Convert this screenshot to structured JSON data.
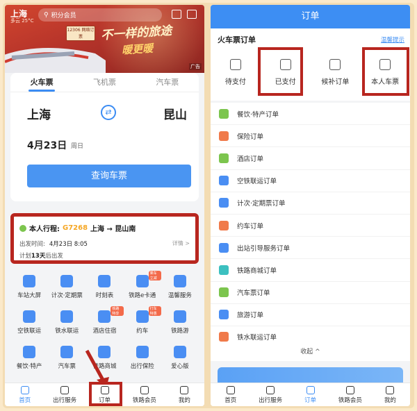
{
  "left": {
    "city": "上海",
    "weather": "多云 25°C",
    "search_placeholder": "积分会员",
    "banner_badge": "12306 网络订票",
    "slogan_1": "不一样的旅途",
    "slogan_2": "暖更暖",
    "ad_label": "广告",
    "tabs": [
      "火车票",
      "飞机票",
      "汽车票"
    ],
    "from": "上海",
    "to": "昆山",
    "date": "4月23日",
    "weekday": "周日",
    "query_button": "查询车票",
    "trip": {
      "label": "本人行程:",
      "train_no": "G7268",
      "route": "上海 → 昆山南",
      "depart_label": "出发时间:",
      "depart_value": "4月23日  8:05",
      "detail": "详情 >",
      "plan_prefix": "计划",
      "plan_days": "13天",
      "plan_suffix": "后出发"
    },
    "services": [
      {
        "label": "车站大屏",
        "color": "#4a8ef3"
      },
      {
        "label": "计次·定期票",
        "color": "#4a8ef3"
      },
      {
        "label": "时刻表",
        "color": "#4a8ef3"
      },
      {
        "label": "铁路e卡通",
        "color": "#4a8ef3",
        "tag": "乘车立减"
      },
      {
        "label": "温馨服务",
        "color": "#4a8ef3"
      },
      {
        "label": "空铁联运",
        "color": "#4a8ef3"
      },
      {
        "label": "铁水联运",
        "color": "#4a8ef3"
      },
      {
        "label": "酒店住宿",
        "color": "#4a8ef3",
        "tag": "铁路特享"
      },
      {
        "label": "约车",
        "color": "#4a8ef3",
        "tag": "打车特惠"
      },
      {
        "label": "铁路游",
        "color": "#4a8ef3"
      },
      {
        "label": "餐饮·特产",
        "color": "#4a8ef3"
      },
      {
        "label": "汽车票",
        "color": "#4a8ef3"
      },
      {
        "label": "铁路商城",
        "color": "#4a8ef3"
      },
      {
        "label": "出行保险",
        "color": "#4a8ef3"
      },
      {
        "label": "爱心版",
        "color": "#4a8ef3"
      }
    ],
    "tabbar": [
      "首页",
      "出行服务",
      "订单",
      "铁路会员",
      "我的"
    ]
  },
  "right": {
    "title": "订单",
    "section_title": "火车票订单",
    "tip": "温馨提示",
    "kinds": [
      "待支付",
      "已支付",
      "候补订单",
      "本人车票"
    ],
    "orders": [
      {
        "label": "餐饮·特产订单",
        "color": "#7cc54e"
      },
      {
        "label": "保险订单",
        "color": "#f07a4a"
      },
      {
        "label": "酒店订单",
        "color": "#7cc54e"
      },
      {
        "label": "空铁联运订单",
        "color": "#4a8ef3"
      },
      {
        "label": "计次·定期票订单",
        "color": "#4a8ef3"
      },
      {
        "label": "约车订单",
        "color": "#f07a4a"
      },
      {
        "label": "出站引导服务订单",
        "color": "#4a8ef3"
      },
      {
        "label": "铁路商城订单",
        "color": "#3cc0c0"
      },
      {
        "label": "汽车票订单",
        "color": "#7cc54e"
      },
      {
        "label": "旅游订单",
        "color": "#4a8ef3"
      },
      {
        "label": "铁水联运订单",
        "color": "#f07a4a"
      }
    ],
    "collapse": "收起 ^",
    "tabbar": [
      "首页",
      "出行服务",
      "订单",
      "铁路会员",
      "我的"
    ]
  },
  "colors": {
    "accent": "#3d8ef3",
    "highlight": "#b8261f"
  }
}
